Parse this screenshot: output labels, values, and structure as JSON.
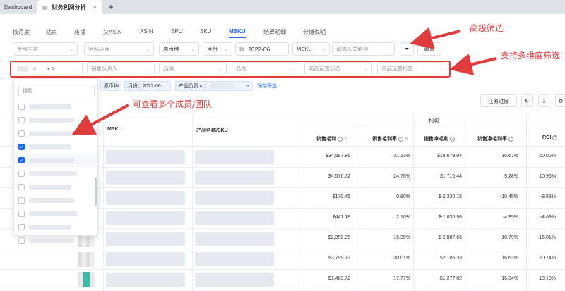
{
  "browser": {
    "tabs": [
      {
        "label": "Dashboard"
      },
      {
        "label": "财务利润分析"
      }
    ],
    "new_tab": "+",
    "close": "×"
  },
  "report_tabs": [
    "按月度",
    "站点",
    "店铺",
    "父ASIN",
    "ASIN",
    "SPU",
    "SKU",
    "MSKU",
    "结算明细",
    "分摊说明"
  ],
  "active_tab": "MSKU",
  "filters": {
    "site": "全部国家",
    "store": "全部店铺",
    "currency": "原币种",
    "period": "月份",
    "month": "2022-06",
    "field": "MSKU",
    "keyword_placeholder": "请输入关键词",
    "reset": "重置",
    "owner_count": "+ 1",
    "sales_owner": "销售负责人",
    "brand": "品牌",
    "category": "品类",
    "product_status": "商品运营状态",
    "product_label": "商品运营标签"
  },
  "chips": {
    "currency": "原币种",
    "month": "月份：2022-06",
    "owner": "产品负责人：",
    "save": "保存筛选"
  },
  "dropdown": {
    "search_placeholder": "搜索",
    "items": [
      {
        "checked": false
      },
      {
        "checked": false
      },
      {
        "checked": false
      },
      {
        "checked": true
      },
      {
        "checked": true
      },
      {
        "checked": false
      },
      {
        "checked": false
      },
      {
        "checked": false
      },
      {
        "checked": false
      },
      {
        "checked": false
      },
      {
        "checked": false
      }
    ]
  },
  "toolbar": {
    "progress": "任务进度",
    "refresh_icon": "↻",
    "download_icon": "⤓",
    "settings_icon": "⚙"
  },
  "table": {
    "group_header": "利润",
    "headers": {
      "msku": "MSKU",
      "product": "产品名称/SKU",
      "gross_profit": "销售毛利",
      "gross_margin": "销售毛利率",
      "net_profit": "销售净毛利",
      "net_margin": "销售净毛利率",
      "roi": "ROI"
    },
    "rows": [
      {
        "gross_profit": "$34,587.86",
        "gross_margin": "31.13%",
        "net_profit": "$18,679.94",
        "net_margin": "16.67%",
        "roi": "20.00%"
      },
      {
        "gross_profit": "$4,576.72",
        "gross_margin": "24.76%",
        "net_profit": "$1,716.44",
        "net_margin": "9.28%",
        "roi": "10.96%"
      },
      {
        "gross_profit": "$170.45",
        "gross_margin": "0.80%",
        "net_profit": "$-2,230.15",
        "net_margin": "-10.45%",
        "roi": "-9.58%"
      },
      {
        "gross_profit": "$441.18",
        "gross_margin": "2.10%",
        "net_profit": "$-1,036.98",
        "net_margin": "-4.95%",
        "roi": "-4.69%"
      },
      {
        "gross_profit": "$2,358.35",
        "gross_margin": "15.35%",
        "net_profit": "$-2,887.66",
        "net_margin": "-18.79%",
        "roi": "-16.01%"
      },
      {
        "gross_profit": "$3,799.73",
        "gross_margin": "30.01%",
        "net_profit": "$2,105.33",
        "net_margin": "16.63%",
        "roi": "20.74%"
      },
      {
        "gross_profit": "$1,480.72",
        "gross_margin": "17.77%",
        "net_profit": "$1,277.82",
        "net_margin": "15.34%",
        "roi": "18.18%"
      }
    ]
  },
  "annotations": {
    "advanced": "高级筛选",
    "multi_dim": "支持多维度筛选",
    "members": "可查看多个成员/团队"
  },
  "colors": {
    "accent": "#1a66ff",
    "annotation": "#e23b3b"
  }
}
